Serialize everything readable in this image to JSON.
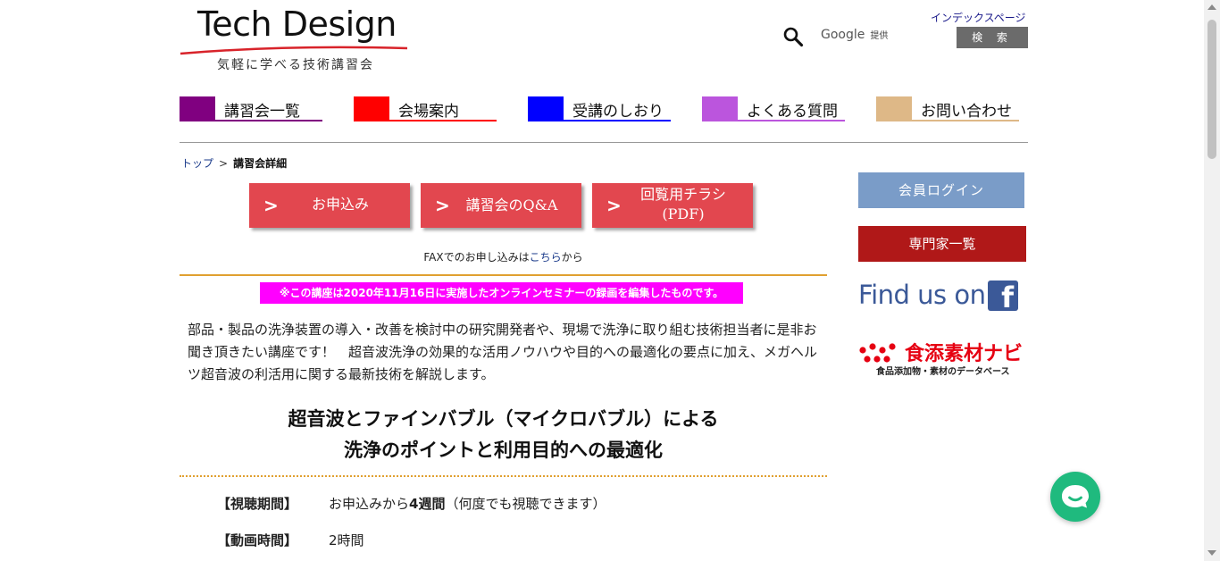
{
  "header": {
    "logo_title": "Tech Design",
    "logo_subtitle": "気軽に学べる技術講習会",
    "google_label": "Google",
    "google_provided": "提供",
    "index_link": "インデックスページ",
    "search_button": "検 索"
  },
  "nav": {
    "items": [
      {
        "label": "講習会一覧",
        "color": "#800080"
      },
      {
        "label": "会場案内",
        "color": "#ff0000"
      },
      {
        "label": "受講のしおり",
        "color": "#0000ff"
      },
      {
        "label": "よくある質問",
        "color": "#bb55dd"
      },
      {
        "label": "お問い合わせ",
        "color": "#deb887"
      }
    ]
  },
  "breadcrumb": {
    "home": "トップ",
    "separator": ">",
    "current": "講習会詳細"
  },
  "actions": {
    "apply": "お申込み",
    "qa": "講習会のQ&A",
    "flyer_line1": "回覧用チラシ",
    "flyer_line2": "(PDF)",
    "chevron": ">"
  },
  "fax": {
    "prefix": "FAXでのお申し込みは",
    "link": "こちら",
    "suffix": "から"
  },
  "notice": "※この講座は2020年11月16日に実施したオンラインセミナーの録画を編集したものです。",
  "intro": "部品・製品の洗浄装置の導入・改善を検討中の研究開発者や、現場で洗浄に取り組む技術担当者に是非お聞き頂きたい講座です！　超音波洗浄の効果的な活用ノウハウや目的への最適化の要点に加え、メガヘルツ超音波の利活用に関する最新技術を解説します。",
  "course": {
    "title_line1": "超音波とファインバブル（マイクロバブル）による",
    "title_line2": "洗浄のポイントと利用目的への最適化"
  },
  "info": {
    "period_label": "【視聴期間】",
    "period_prefix": "お申込みから",
    "period_bold": "4週間",
    "period_suffix": "（何度でも視聴できます）",
    "duration_label": "【動画時間】",
    "duration_value": "2時間"
  },
  "sidebar": {
    "login": "会員ログイン",
    "experts": "専門家一覧",
    "findus": "Find us on",
    "fb_letter": "f",
    "shoku_name": "食添素材ナビ",
    "shoku_sub": "食品添加物・素材のデータベース"
  },
  "colors": {
    "accent_red": "#e2474f",
    "notice_bg": "#ff00ff",
    "chat_green": "#1fba7e"
  }
}
